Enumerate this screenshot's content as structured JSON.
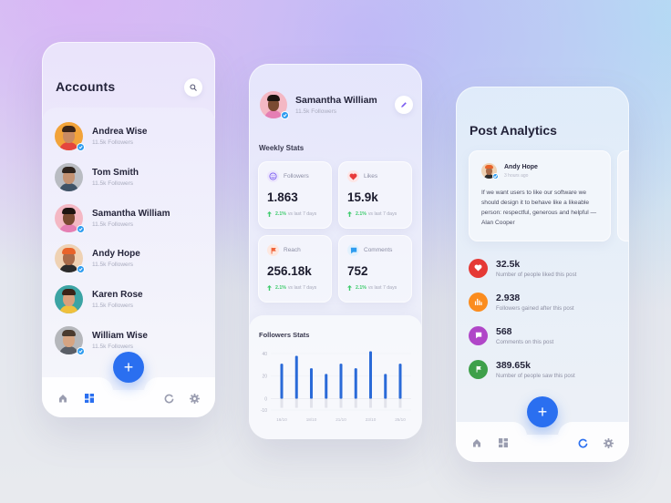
{
  "accounts_screen": {
    "title": "Accounts",
    "search_icon": "search-icon",
    "accounts": [
      {
        "name": "Andrea Wise",
        "followers": "11.5k Followers",
        "verified": true,
        "avatar_bg": "#f2a33a",
        "skin": "#c98b63",
        "hair": "#3a2418",
        "shirt": "#e4463e"
      },
      {
        "name": "Tom Smith",
        "followers": "11.5k Followers",
        "verified": false,
        "avatar_bg": "#b9bcc2",
        "skin": "#c49272",
        "hair": "#2e231d",
        "shirt": "#3f5266"
      },
      {
        "name": "Samantha William",
        "followers": "11.5k Followers",
        "verified": true,
        "avatar_bg": "#f4b8c4",
        "skin": "#7a4a32",
        "hair": "#1d1410",
        "shirt": "#e57fb4"
      },
      {
        "name": "Andy Hope",
        "followers": "11.5k Followers",
        "verified": true,
        "avatar_bg": "#efd2b4",
        "skin": "#a86b4a",
        "hair": "#e8632a",
        "shirt": "#2b2b2b"
      },
      {
        "name": "Karen Rose",
        "followers": "11.5k Followers",
        "verified": false,
        "avatar_bg": "#3ca4a4",
        "skin": "#d9a07c",
        "hair": "#3a2318",
        "shirt": "#f0c03c"
      },
      {
        "name": "William Wise",
        "followers": "11.5k Followers",
        "verified": true,
        "avatar_bg": "#b5b7bb",
        "skin": "#d6a482",
        "hair": "#4a3a2e",
        "shirt": "#5a5e66"
      }
    ],
    "nav": {
      "home": "home-icon",
      "dashboard": "dashboard-icon",
      "add": "+",
      "refresh": "refresh-icon",
      "settings": "gear-icon",
      "active": "dashboard"
    }
  },
  "profile_screen": {
    "name": "Samantha William",
    "followers": "11.5k Followers",
    "edit_icon": "pencil-icon",
    "weekly_stats_label": "Weekly Stats",
    "stats": [
      {
        "label": "Followers",
        "value": "1.863",
        "delta": "2.1%",
        "delta_text": "vs last 7 days",
        "icon": "smiley-icon",
        "icon_color": "#7a5cf0",
        "icon_bg": "#ece6fd"
      },
      {
        "label": "Likes",
        "value": "15.9k",
        "delta": "2.1%",
        "delta_text": "vs last 7 days",
        "icon": "heart-icon",
        "icon_color": "#e83a3a",
        "icon_bg": "#fde6e6"
      },
      {
        "label": "Reach",
        "value": "256.18k",
        "delta": "2.1%",
        "delta_text": "vs last 7 days",
        "icon": "flag-icon",
        "icon_color": "#f0643a",
        "icon_bg": "#fde8e0"
      },
      {
        "label": "Comments",
        "value": "752",
        "delta": "2.1%",
        "delta_text": "vs last 7 days",
        "icon": "comment-icon",
        "icon_color": "#2d9cf0",
        "icon_bg": "#e2f1fd"
      }
    ],
    "followers_stats_label": "Followers Stats"
  },
  "chart_data": {
    "type": "bar",
    "title": "Followers Stats",
    "xlabel": "",
    "ylabel": "",
    "ylim": [
      -10,
      40
    ],
    "yticks": [
      "40",
      "20",
      "0",
      "-10"
    ],
    "ytick_values": [
      40,
      20,
      0,
      -10
    ],
    "xtick_labels": [
      "16/10",
      "18/10",
      "21/10",
      "23/10",
      "25/10"
    ],
    "values": [
      31,
      38,
      27,
      22,
      31,
      27,
      42,
      22,
      31
    ],
    "reflection_values": [
      -8,
      -8,
      -8,
      -8,
      -8,
      -8,
      -8,
      -8,
      -8
    ],
    "bar_color": "#2a6ad8",
    "grid": true
  },
  "analytics_screen": {
    "title": "Post Analytics",
    "post": {
      "author": "Andy Hope",
      "time": "3 hours ago",
      "text": "If we want users to like our software we should design it to behave like a likeable person: respectful, generous and helpful — Alan Cooper"
    },
    "metrics": [
      {
        "value": "32.5k",
        "label": "Number of people liked this post",
        "icon": "heart-icon",
        "color": "#e53935"
      },
      {
        "value": "2.938",
        "label": "Followers gained after this post",
        "icon": "bar-chart-icon",
        "color": "#fb8c1e"
      },
      {
        "value": "568",
        "label": "Comments on this post",
        "icon": "comment-icon",
        "color": "#b046c8"
      },
      {
        "value": "389.65k",
        "label": "Number of people saw this post",
        "icon": "flag-icon",
        "color": "#3ea04a"
      }
    ],
    "nav": {
      "home": "home-icon",
      "dashboard": "dashboard-icon",
      "add": "+",
      "refresh": "refresh-icon",
      "settings": "gear-icon",
      "active": "refresh"
    }
  }
}
